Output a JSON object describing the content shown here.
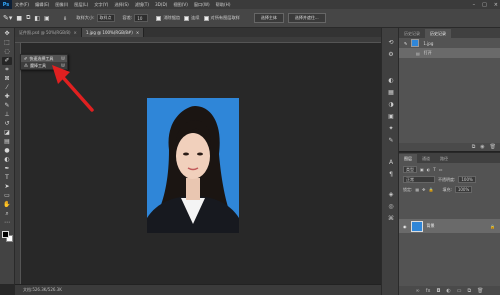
{
  "app": {
    "logo": "Ps"
  },
  "menu": [
    "文件(F)",
    "编辑(E)",
    "图像(I)",
    "图层(L)",
    "文字(Y)",
    "选择(S)",
    "滤镜(T)",
    "3D(D)",
    "视图(V)",
    "窗口(W)",
    "帮助(H)"
  ],
  "window_controls": {
    "minimize": "–",
    "maximize": "□",
    "close": "×"
  },
  "options": {
    "brush_size": "8",
    "sample_label": "取样大小:",
    "sample_value": "取样点",
    "tolerance_label": "容差:",
    "tolerance_value": "10",
    "antialias_label": "消除锯齿",
    "contiguous_label": "连续",
    "sample_all_label": "对所有图层取样",
    "select_subject": "选择主体",
    "select_mask": "选择并遮住..."
  },
  "tabs": [
    {
      "label": "证件照.psd @ 50%(RGB/8)",
      "close": "×",
      "active": false
    },
    {
      "label": "1.jpg @ 100%(RGB/8#)",
      "close": "×",
      "active": true
    }
  ],
  "tools": [
    "move-icon",
    "marquee-icon",
    "lasso-icon",
    "quick-select-icon",
    "crop-icon",
    "frame-icon",
    "eyedropper-icon",
    "healing-icon",
    "brush-icon",
    "stamp-icon",
    "history-brush-icon",
    "eraser-icon",
    "gradient-icon",
    "blur-icon",
    "dodge-icon",
    "pen-icon",
    "type-icon",
    "path-select-icon",
    "rectangle-icon",
    "hand-icon",
    "zoom-icon",
    "more-icon"
  ],
  "flyout": [
    {
      "label": "快速选择工具",
      "shortcut": "W",
      "active": false
    },
    {
      "label": "魔棒工具",
      "shortcut": "W",
      "active": true
    }
  ],
  "status": "文档:526.3K/526.3K",
  "history": {
    "tabs": [
      "历史记录",
      "历史记录"
    ],
    "source": "1.jpg",
    "items": [
      "打开"
    ]
  },
  "layers": {
    "tabs": [
      "图层",
      "通道",
      "路径"
    ],
    "kind_label": "类型",
    "blend_mode": "正常",
    "opacity_label": "不透明度:",
    "opacity_value": "100%",
    "lock_label": "锁定:",
    "fill_label": "填充:",
    "fill_value": "100%",
    "layer_name": "背景"
  },
  "colors": {
    "photo_background": "#2f86d8",
    "arrow": "#e02020",
    "foreground": "#000000",
    "background": "#ffffff"
  }
}
